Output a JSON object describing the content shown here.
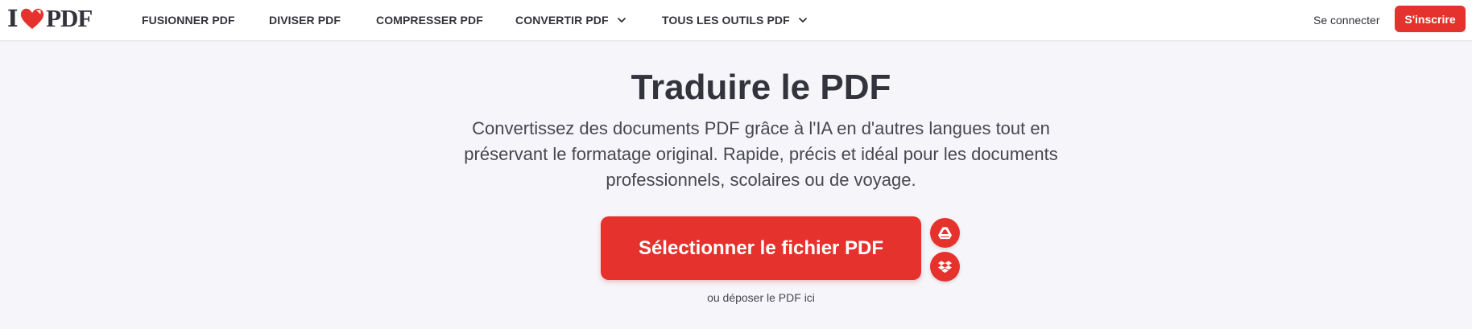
{
  "logo": {
    "text_left": "I",
    "text_right": "PDF",
    "heart_color": "#e5322d"
  },
  "nav": {
    "items": [
      {
        "label": "FUSIONNER PDF",
        "dropdown": false
      },
      {
        "label": "DIVISER PDF",
        "dropdown": false
      },
      {
        "label": "COMPRESSER PDF",
        "dropdown": false
      },
      {
        "label": "CONVERTIR PDF",
        "dropdown": true
      },
      {
        "label": "TOUS LES OUTILS PDF",
        "dropdown": true
      }
    ],
    "login_label": "Se connecter",
    "signup_label": "S'inscrire"
  },
  "hero": {
    "title": "Traduire le PDF",
    "subtitle": "Convertissez des documents PDF grâce à l'IA en d'autres langues tout en préservant le formatage original. Rapide, précis et idéal pour les documents professionnels, scolaires ou de voyage.",
    "select_button_label": "Sélectionner le fichier PDF",
    "cloud_buttons": [
      {
        "icon": "google-drive-icon"
      },
      {
        "icon": "dropbox-icon"
      }
    ],
    "drop_hint": "ou déposer le PDF ici"
  },
  "colors": {
    "accent": "#e5322d",
    "background": "#f5f5fa",
    "header_background": "#ffffff",
    "text": "#33333b"
  }
}
